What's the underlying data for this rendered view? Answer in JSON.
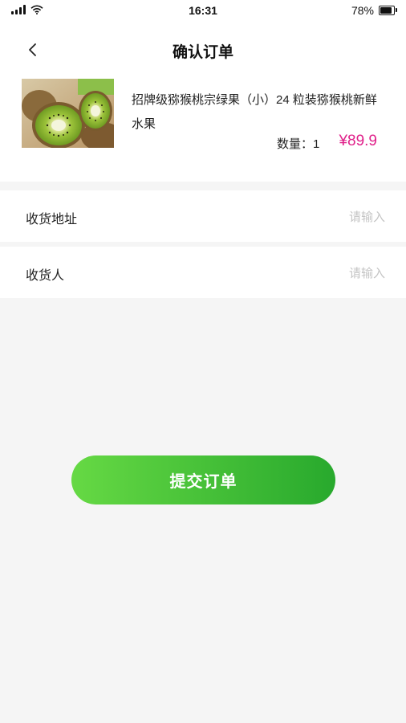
{
  "status_bar": {
    "time": "16:31",
    "battery": "78%",
    "battery_level": 0.78
  },
  "header": {
    "title": "确认订单"
  },
  "product": {
    "name": "招牌级猕猴桃宗绿果（小）24 粒装猕猴桃新鲜水果",
    "quantity_label": "数量：1",
    "price": "¥89.9"
  },
  "form": {
    "address": {
      "label": "收货地址",
      "placeholder": "请输入"
    },
    "receiver": {
      "label": "收货人",
      "placeholder": "请输入"
    }
  },
  "actions": {
    "submit_label": "提交订单"
  },
  "colors": {
    "accent": "#28a92d",
    "accent_light": "#66d944",
    "price": "#e0208a",
    "background": "#f5f5f5"
  }
}
